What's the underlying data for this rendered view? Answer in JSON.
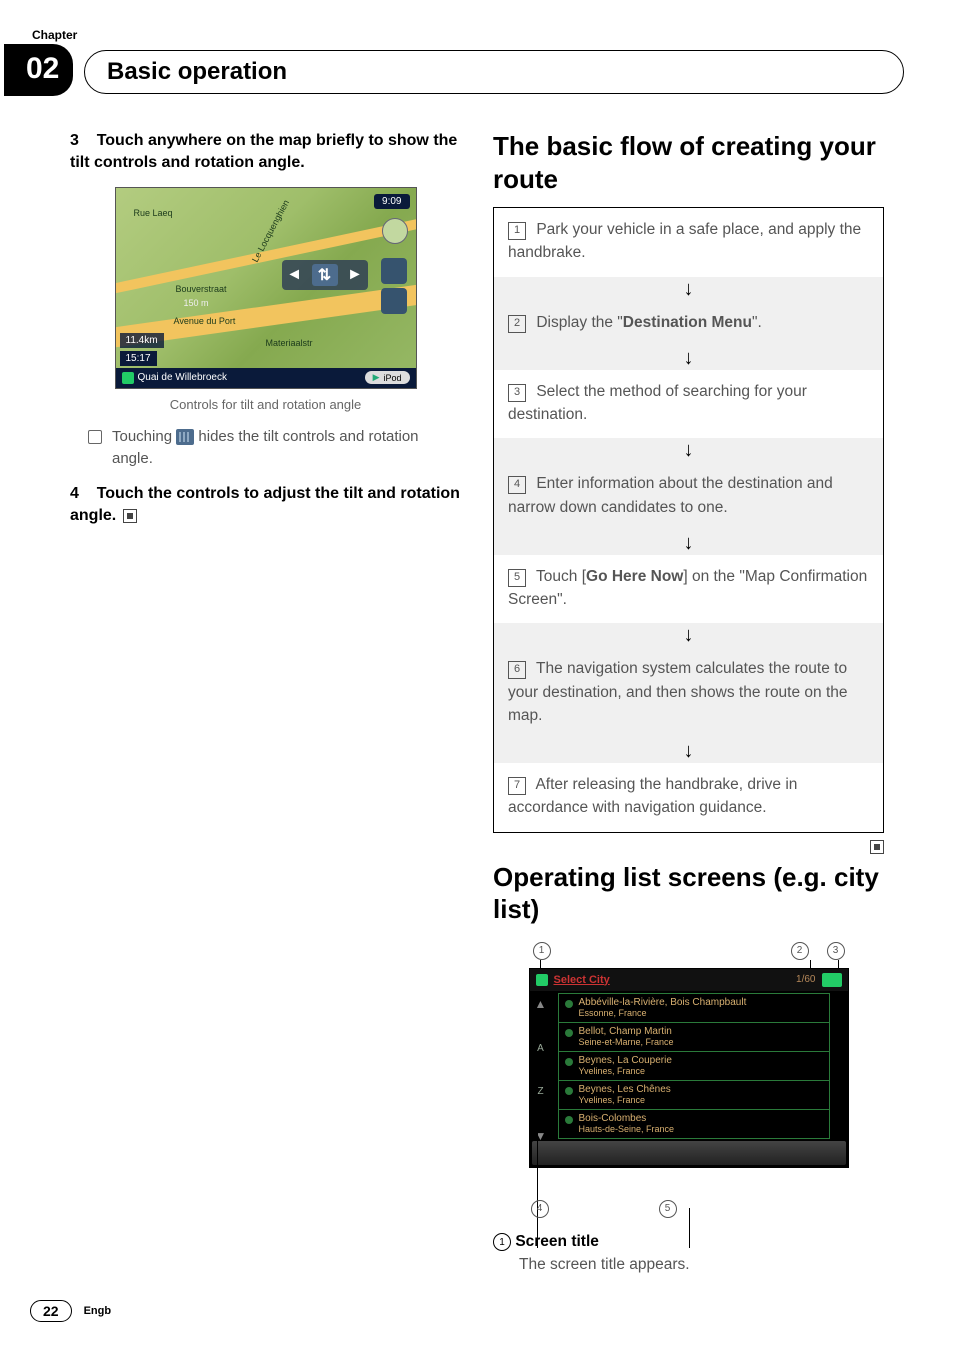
{
  "header": {
    "chapter_label": "Chapter",
    "chapter_number": "02",
    "title": "Basic operation"
  },
  "left_column": {
    "step3": {
      "number": "3",
      "text": "Touch anywhere on the map briefly to show the tilt controls and rotation angle."
    },
    "map": {
      "time": "9:09",
      "street1": "Rue Laeq",
      "street2": "Le Locquenghien",
      "street3": "Bouverstraat",
      "street4": "Avenue du Port",
      "street5": "Materiaalstr",
      "scale": "150 m",
      "distance": "11.4km",
      "eta": "15:17",
      "bottom_label": "Quai de Willebroeck",
      "ipod": "iPod"
    },
    "caption": "Controls for tilt and rotation angle",
    "note_prefix": "Touching ",
    "note_suffix": " hides the tilt controls and rotation angle.",
    "step4": {
      "number": "4",
      "text": "Touch the controls to adjust the tilt and rotation angle."
    }
  },
  "right_column": {
    "flow_heading": "The basic flow of creating your route",
    "steps": [
      {
        "n": "1",
        "text_pre": "Park your vehicle in a safe place, and apply the handbrake."
      },
      {
        "n": "2",
        "text_pre": "Display the \"",
        "bold": "Destination Menu",
        "text_post": "\"."
      },
      {
        "n": "3",
        "text_pre": "Select the method of searching for your destination."
      },
      {
        "n": "4",
        "text_pre": "Enter information about the destination and narrow down candidates to one."
      },
      {
        "n": "5",
        "text_pre": "Touch [",
        "bold": "Go Here Now",
        "text_post": "] on the \"Map Confirmation Screen\"."
      },
      {
        "n": "6",
        "text_pre": "The navigation system calculates the route to your destination, and then shows the route on the map."
      },
      {
        "n": "7",
        "text_pre": "After releasing the handbrake, drive in accordance with navigation guidance."
      }
    ],
    "list_heading": "Operating list screens (e.g. city list)",
    "list_screen": {
      "title": "Select City",
      "count": "1/60",
      "rows": [
        {
          "l1": "Abbéville-la-Rivière, Bois Champbault",
          "l2": "Essonne, France"
        },
        {
          "l1": "Bellot, Champ Martin",
          "l2": "Seine-et-Marne, France"
        },
        {
          "l1": "Beynes, La Couperie",
          "l2": "Yvelines, France"
        },
        {
          "l1": "Beynes, Les Chênes",
          "l2": "Yvelines, France"
        },
        {
          "l1": "Bois-Colombes",
          "l2": "Hauts-de-Seine, France"
        }
      ]
    },
    "callouts": {
      "c1": "1",
      "c2": "2",
      "c3": "3",
      "c4": "4",
      "c5": "5"
    },
    "desc": {
      "num": "1",
      "label": "Screen title",
      "body": "The screen title appears."
    }
  },
  "footer": {
    "page": "22",
    "lang": "Engb"
  }
}
